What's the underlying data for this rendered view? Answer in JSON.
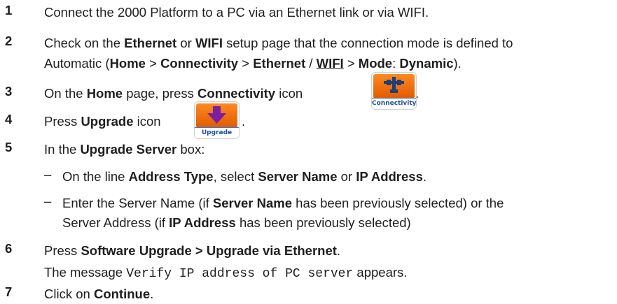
{
  "steps": [
    {
      "num": "1",
      "text": "Connect the 2000 Platform to a PC via an Ethernet link or via WIFI."
    },
    {
      "num": "2",
      "line1": {
        "a": "Check on the ",
        "b": "Ethernet",
        "c": " or ",
        "d": "WIFI",
        "e": " setup page that the connection mode is defined to"
      },
      "line2": {
        "a": "Automatic (",
        "b": "Home",
        "c": " > ",
        "d": "Connectivity",
        "e": " > ",
        "f": "Ethernet",
        "g": " / ",
        "h": "WIFI",
        "i": " > ",
        "j": "Mode",
        "k": ": ",
        "l": "Dynamic",
        "m": ")."
      }
    },
    {
      "num": "3",
      "a": "On the ",
      "b": "Home",
      "c": " page, press ",
      "d": "Connectivity",
      "e": " icon",
      "icon_label": "Connectivity",
      "icon": "connectivity-icon",
      "after": "."
    },
    {
      "num": "4",
      "a": "Press ",
      "b": "Upgrade",
      "c": " icon",
      "icon_label": "Upgrade",
      "icon": "upgrade-icon",
      "after": "."
    },
    {
      "num": "5",
      "a": "In the ",
      "b": "Upgrade Server",
      "c": " box:",
      "subs": [
        {
          "dash": "–",
          "a": "On the line ",
          "b": "Address Type",
          "c": ", select ",
          "d": "Server Name",
          "e": " or ",
          "f": "IP Address",
          "g": "."
        },
        {
          "dash": "–",
          "line1": {
            "a": "Enter the Server Name (if ",
            "b": "Server Name",
            "c": " has been previously selected) or the"
          },
          "line2": {
            "a": "Server Address (if ",
            "b": "IP Address",
            "c": " has been previously selected)"
          }
        }
      ]
    },
    {
      "num": "6",
      "a": "Press ",
      "b": "Software Upgrade > Upgrade via Ethernet",
      "c": ".",
      "msg": {
        "a": "The message ",
        "b": "Verify IP address of PC server",
        "c": " appears."
      }
    },
    {
      "num": "7",
      "a": "Click on ",
      "b": "Continue",
      "c": "."
    }
  ],
  "colors": {
    "text": "#1e1e1e",
    "icon_orange": "#f07c1a",
    "icon_label_blue": "#1d4e9b",
    "connectivity_glyph": "#1e3f78",
    "upgrade_arrow": "#7b1fa2"
  }
}
